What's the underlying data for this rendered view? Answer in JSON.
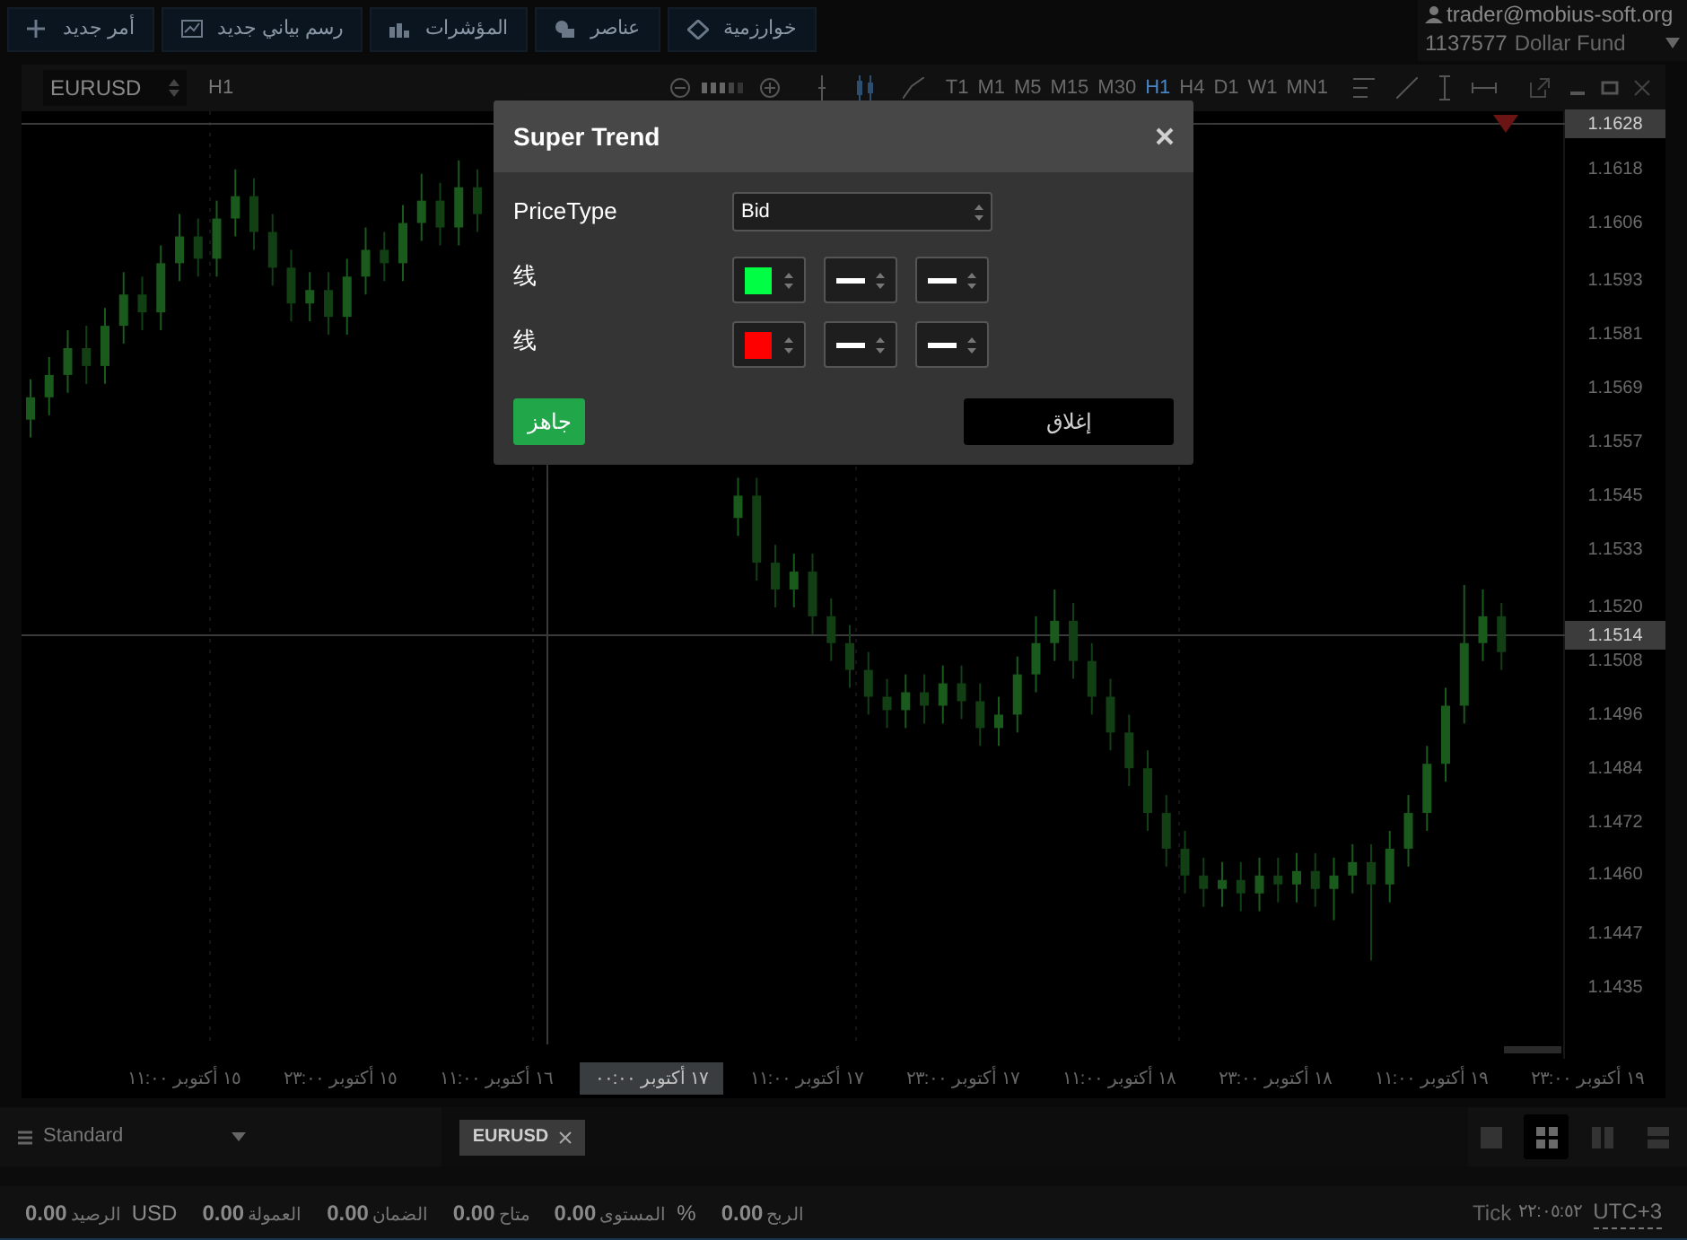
{
  "toolbar": {
    "buttons": [
      {
        "label": "خوارزمية",
        "kind": "diamond"
      },
      {
        "label": "عناصر",
        "kind": "shapes"
      },
      {
        "label": "المؤشرات",
        "kind": "bars"
      },
      {
        "label": "رسم بياني جديد",
        "kind": "chart"
      },
      {
        "label": "أمر جديد",
        "kind": "plus"
      }
    ]
  },
  "account": {
    "user": "trader@mobius-soft.org",
    "number": "1137577",
    "name": "Dollar Fund"
  },
  "chart_window": {
    "symbol": "EURUSD",
    "period": "H1",
    "timeframes": [
      {
        "label": "MN1",
        "selected": false
      },
      {
        "label": "W1",
        "selected": false
      },
      {
        "label": "D1",
        "selected": false
      },
      {
        "label": "H4",
        "selected": false
      },
      {
        "label": "H1",
        "selected": true
      },
      {
        "label": "M30",
        "selected": false
      },
      {
        "label": "M15",
        "selected": false
      },
      {
        "label": "M5",
        "selected": false
      },
      {
        "label": "M1",
        "selected": false
      },
      {
        "label": "T1",
        "selected": false
      }
    ],
    "price_markers": [
      {
        "text": "1.1628",
        "kind": "top-line"
      },
      {
        "text": "1.1514",
        "kind": "crosshair"
      }
    ],
    "time_labels": [
      {
        "text": "١٩ أكتوبر ٢٣:٠٠",
        "highlighted": false
      },
      {
        "text": "١٩ أكتوبر ١١:٠٠",
        "highlighted": false
      },
      {
        "text": "١٨ أكتوبر ٢٣:٠٠",
        "highlighted": false
      },
      {
        "text": "١٨ أكتوبر ١١:٠٠",
        "highlighted": false
      },
      {
        "text": "١٧ أكتوبر ٢٣:٠٠",
        "highlighted": false
      },
      {
        "text": "١٧ أكتوبر ١١:٠٠",
        "highlighted": false
      },
      {
        "text": "١٧ أكتوبر ٠٠:٠٠",
        "highlighted": true
      },
      {
        "text": "١٦ أكتوبر ١١:٠٠",
        "highlighted": false
      },
      {
        "text": "١٥ أكتوبر ٢٣:٠٠",
        "highlighted": false
      },
      {
        "text": "١٥ أكتوبر ١١:٠٠",
        "highlighted": false
      }
    ],
    "chart_data": {
      "type": "candlestick",
      "ylim": [
        1.1419,
        1.1631
      ],
      "yticks": [
        {
          "value": 1.1618,
          "label": "1.1618"
        },
        {
          "value": 1.1606,
          "label": "1.1606"
        },
        {
          "value": 1.1593,
          "label": "1.1593"
        },
        {
          "value": 1.1581,
          "label": "1.1581"
        },
        {
          "value": 1.1569,
          "label": "1.1569"
        },
        {
          "value": 1.1557,
          "label": "1.1557"
        },
        {
          "value": 1.1545,
          "label": "1.1545"
        },
        {
          "value": 1.1533,
          "label": "1.1533"
        },
        {
          "value": 1.152,
          "label": "1.1520"
        },
        {
          "value": 1.1508,
          "label": "1.1508"
        },
        {
          "value": 1.1496,
          "label": "1.1496"
        },
        {
          "value": 1.1484,
          "label": "1.1484"
        },
        {
          "value": 1.1472,
          "label": "1.1472"
        },
        {
          "value": 1.146,
          "label": "1.1460"
        },
        {
          "value": 1.1447,
          "label": "1.1447"
        },
        {
          "value": 1.1435,
          "label": "1.1435"
        }
      ],
      "ohlc": [
        [
          1.1562,
          1.1571,
          1.1558,
          1.1567
        ],
        [
          1.1567,
          1.1576,
          1.1563,
          1.1572
        ],
        [
          1.1572,
          1.1582,
          1.1568,
          1.1578
        ],
        [
          1.1578,
          1.1583,
          1.157,
          1.1574
        ],
        [
          1.1574,
          1.1587,
          1.157,
          1.1583
        ],
        [
          1.1583,
          1.1595,
          1.1579,
          1.159
        ],
        [
          1.159,
          1.1594,
          1.1582,
          1.1586
        ],
        [
          1.1586,
          1.1601,
          1.1582,
          1.1597
        ],
        [
          1.1597,
          1.1608,
          1.1593,
          1.1603
        ],
        [
          1.1603,
          1.1607,
          1.1594,
          1.1598
        ],
        [
          1.1598,
          1.1611,
          1.1594,
          1.1607
        ],
        [
          1.1607,
          1.1618,
          1.1603,
          1.1612
        ],
        [
          1.1612,
          1.1616,
          1.16,
          1.1604
        ],
        [
          1.1604,
          1.1608,
          1.1592,
          1.1596
        ],
        [
          1.1596,
          1.16,
          1.1584,
          1.1588
        ],
        [
          1.1588,
          1.1595,
          1.1584,
          1.1591
        ],
        [
          1.1591,
          1.1595,
          1.1581,
          1.1585
        ],
        [
          1.1585,
          1.1598,
          1.1581,
          1.1594
        ],
        [
          1.1594,
          1.1605,
          1.159,
          1.16
        ],
        [
          1.16,
          1.1604,
          1.1593,
          1.1597
        ],
        [
          1.1597,
          1.161,
          1.1593,
          1.1606
        ],
        [
          1.1606,
          1.1617,
          1.1602,
          1.1611
        ],
        [
          1.1611,
          1.1615,
          1.1601,
          1.1605
        ],
        [
          1.1605,
          1.162,
          1.1601,
          1.1614
        ],
        [
          1.1614,
          1.1618,
          1.1604,
          1.1608
        ],
        null,
        null,
        null,
        null,
        null,
        null,
        null,
        null,
        null,
        null,
        null,
        null,
        null,
        [
          1.154,
          1.1549,
          1.1536,
          1.1545
        ],
        [
          1.1545,
          1.1549,
          1.1526,
          1.153
        ],
        [
          1.153,
          1.1534,
          1.152,
          1.1524
        ],
        [
          1.1524,
          1.1532,
          1.152,
          1.1528
        ],
        [
          1.1528,
          1.1532,
          1.1514,
          1.1518
        ],
        [
          1.1518,
          1.1522,
          1.1508,
          1.1512
        ],
        [
          1.1512,
          1.1516,
          1.1502,
          1.1506
        ],
        [
          1.1506,
          1.151,
          1.1496,
          1.15
        ],
        [
          1.15,
          1.1504,
          1.1493,
          1.1497
        ],
        [
          1.1497,
          1.1505,
          1.1493,
          1.1501
        ],
        [
          1.1501,
          1.1505,
          1.1494,
          1.1498
        ],
        [
          1.1498,
          1.1507,
          1.1494,
          1.1503
        ],
        [
          1.1503,
          1.1507,
          1.1495,
          1.1499
        ],
        [
          1.1499,
          1.1503,
          1.1489,
          1.1493
        ],
        [
          1.1493,
          1.15,
          1.1489,
          1.1496
        ],
        [
          1.1496,
          1.1509,
          1.1492,
          1.1505
        ],
        [
          1.1505,
          1.1518,
          1.1501,
          1.1512
        ],
        [
          1.1512,
          1.1524,
          1.1508,
          1.1517
        ],
        [
          1.1517,
          1.1521,
          1.1504,
          1.1508
        ],
        [
          1.1508,
          1.1512,
          1.1496,
          1.15
        ],
        [
          1.15,
          1.1504,
          1.1488,
          1.1492
        ],
        [
          1.1492,
          1.1496,
          1.148,
          1.1484
        ],
        [
          1.1484,
          1.1488,
          1.147,
          1.1474
        ],
        [
          1.1474,
          1.1478,
          1.1462,
          1.1466
        ],
        [
          1.1466,
          1.147,
          1.1456,
          1.146
        ],
        [
          1.146,
          1.1464,
          1.1453,
          1.1457
        ],
        [
          1.1457,
          1.1463,
          1.1453,
          1.1459
        ],
        [
          1.1459,
          1.1463,
          1.1452,
          1.1456
        ],
        [
          1.1456,
          1.1464,
          1.1452,
          1.146
        ],
        [
          1.146,
          1.1464,
          1.1454,
          1.1458
        ],
        [
          1.1458,
          1.1465,
          1.1454,
          1.1461
        ],
        [
          1.1461,
          1.1465,
          1.1453,
          1.1457
        ],
        [
          1.1457,
          1.1464,
          1.145,
          1.146
        ],
        [
          1.146,
          1.1467,
          1.1456,
          1.1463
        ],
        [
          1.1463,
          1.1467,
          1.1441,
          1.1458
        ],
        [
          1.1458,
          1.147,
          1.1454,
          1.1466
        ],
        [
          1.1466,
          1.1478,
          1.1462,
          1.1474
        ],
        [
          1.1474,
          1.1489,
          1.147,
          1.1485
        ],
        [
          1.1485,
          1.1502,
          1.1481,
          1.1498
        ],
        [
          1.1498,
          1.1525,
          1.1494,
          1.1512
        ],
        [
          1.1512,
          1.1524,
          1.1508,
          1.1518
        ],
        [
          1.1518,
          1.1521,
          1.1506,
          1.151
        ]
      ]
    }
  },
  "bottom_bar": {
    "layout_name": "Standard",
    "tabs": [
      {
        "label": "EURUSD"
      }
    ],
    "layouts": [
      {
        "kind": "single",
        "selected": false
      },
      {
        "kind": "grid",
        "selected": true
      },
      {
        "kind": "columns",
        "selected": false
      },
      {
        "kind": "rows",
        "selected": false
      }
    ]
  },
  "status_bar": {
    "items": [
      {
        "value": "0.00",
        "label": "الربح"
      },
      {
        "value": "0.00",
        "label": "المستوى",
        "suffix": "%"
      },
      {
        "value": "0.00",
        "label": "متاح"
      },
      {
        "value": "0.00",
        "label": "الضمان"
      },
      {
        "value": "0.00",
        "label": "العمولة"
      },
      {
        "value": "0.00",
        "label": "الرصيد",
        "suffix": "USD"
      }
    ],
    "tick_label": "Tick",
    "tick_time": "٢٢:٠٥:٥٢",
    "timezone": "UTC+3"
  },
  "dialog": {
    "title": "Super Trend",
    "fields": [
      {
        "kind": "select",
        "label": "PriceType",
        "value": "Bid"
      },
      {
        "kind": "line",
        "label": "线",
        "color": "#00ff44"
      },
      {
        "kind": "line",
        "label": "线",
        "color": "#ff0000"
      }
    ],
    "ok_button": "جاهز",
    "close_button": "إغلاق"
  }
}
